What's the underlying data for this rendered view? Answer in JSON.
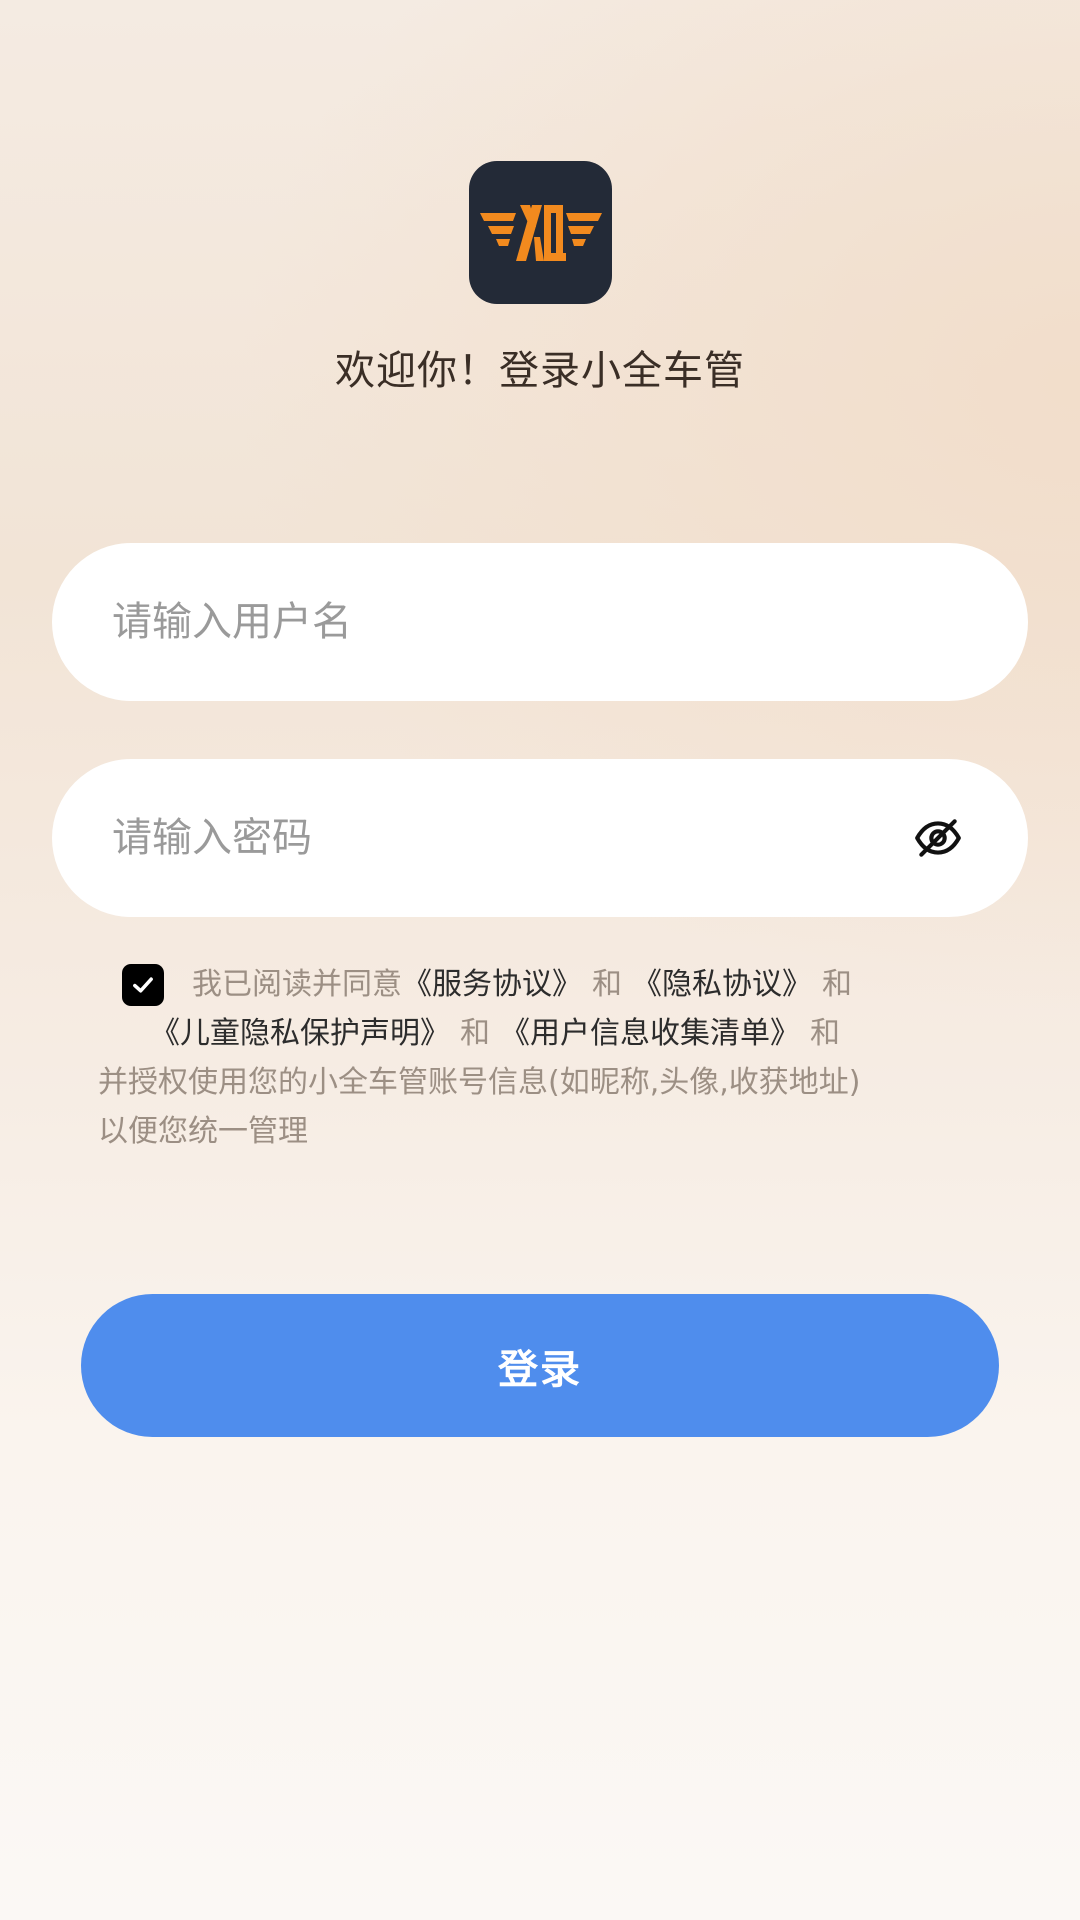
{
  "app": {
    "logo_icon": "xq-wings-logo-icon",
    "welcome_text": "欢迎你！登录小全车管"
  },
  "form": {
    "username_placeholder": "请输入用户名",
    "password_placeholder": "请输入密码",
    "password_toggle_icon": "eye-off-icon",
    "submit_label": "登录"
  },
  "agreement": {
    "checked": true,
    "checkbox_icon": "check-icon",
    "prefix": "我已阅读并同意",
    "conjunction": "和",
    "links": {
      "service": "《服务协议》",
      "privacy": "《隐私协议》",
      "child_privacy": "《儿童隐私保护声明》",
      "info_collection": "《用户信息收集清单》"
    },
    "suffix_line3": "并授权使用您的小全车管账号信息(如昵称,头像,收获地址)",
    "suffix_line4": "以便您统一管理"
  },
  "colors": {
    "primary_button": "#4f8ded",
    "logo_background": "#232a37",
    "logo_accent": "#f28a1e"
  }
}
